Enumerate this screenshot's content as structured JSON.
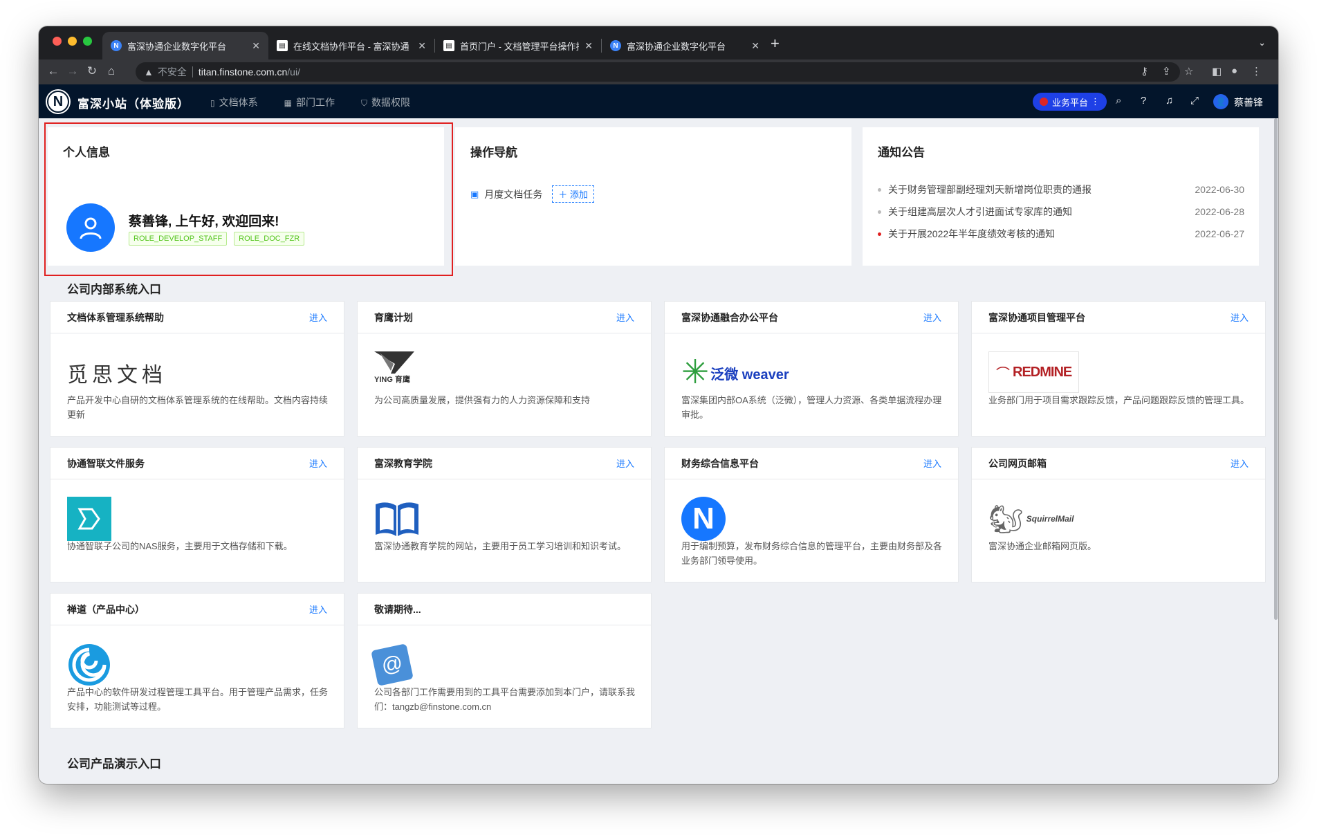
{
  "browser": {
    "tabs": [
      {
        "title": "富深协通企业数字化平台",
        "favicon": "N"
      },
      {
        "title": "在线文档协作平台 - 富深协通",
        "favicon": "doc"
      },
      {
        "title": "首页门户 - 文档管理平台操作指南",
        "favicon": "doc"
      },
      {
        "title": "富深协通企业数字化平台",
        "favicon": "N"
      }
    ],
    "security_label": "不安全",
    "url_host": "titan.finstone.com.cn",
    "url_path": "/ui/"
  },
  "header": {
    "logo": "N",
    "site_name": "富深小站（体验版）",
    "nav": [
      {
        "label": "文档体系",
        "icon": "document-icon"
      },
      {
        "label": "部门工作",
        "icon": "grid-icon"
      },
      {
        "label": "数据权限",
        "icon": "shield-icon"
      }
    ],
    "platform_button": "业务平台",
    "user_name": "蔡善锋"
  },
  "profile": {
    "title": "个人信息",
    "greeting": "蔡善锋, 上午好, 欢迎回来!",
    "roles": [
      "ROLE_DEVELOP_STAFF",
      "ROLE_DOC_FZR"
    ]
  },
  "operation_nav": {
    "title": "操作导航",
    "item": "月度文档任务",
    "add_label": "添加"
  },
  "notices": {
    "title": "通知公告",
    "items": [
      {
        "text": "关于财务管理部副经理刘天新增岗位职责的通报",
        "date": "2022-06-30",
        "highlight": false
      },
      {
        "text": "关于组建高层次人才引进面试专家库的通知",
        "date": "2022-06-28",
        "highlight": false
      },
      {
        "text": "关于开展2022年半年度绩效考核的通知",
        "date": "2022-06-27",
        "highlight": true
      }
    ]
  },
  "internal": {
    "title": "公司内部系统入口",
    "enter_label": "进入",
    "cards": [
      {
        "title": "文档体系管理系统帮助",
        "logo_text": "觅思文档",
        "desc": "产品开发中心自研的文档体系管理系统的在线帮助。文档内容持续更新",
        "has_enter": true
      },
      {
        "title": "育鹰计划",
        "logo_text": "YING 育鹰",
        "desc": "为公司高质量发展，提供强有力的人力资源保障和支持",
        "has_enter": true
      },
      {
        "title": "富深协通融合办公平台",
        "logo_text": "泛微 weaver",
        "desc": "富深集团内部OA系统（泛微），管理人力资源、各类单据流程办理审批。",
        "has_enter": true
      },
      {
        "title": "富深协通项目管理平台",
        "logo_text": "REDMINE",
        "desc": "业务部门用于项目需求跟踪反馈，产品问题跟踪反馈的管理工具。",
        "has_enter": true
      },
      {
        "title": "协通智联文件服务",
        "logo_text": "",
        "desc": "协通智联子公司的NAS服务，主要用于文档存储和下载。",
        "has_enter": true
      },
      {
        "title": "富深教育学院",
        "logo_text": "",
        "desc": "富深协通教育学院的网站，主要用于员工学习培训和知识考试。",
        "has_enter": true
      },
      {
        "title": "财务综合信息平台",
        "logo_text": "N",
        "desc": "用于编制预算，发布财务综合信息的管理平台，主要由财务部及各业务部门领导使用。",
        "has_enter": true
      },
      {
        "title": "公司网页邮箱",
        "logo_text": "SquirrelMail",
        "desc": "富深协通企业邮箱网页版。",
        "has_enter": true
      },
      {
        "title": "禅道（产品中心）",
        "logo_text": "",
        "desc": "产品中心的软件研发过程管理工具平台。用于管理产品需求，任务安排，功能测试等过程。",
        "has_enter": true
      },
      {
        "title": "敬请期待...",
        "logo_text": "@",
        "desc": "公司各部门工作需要用到的工具平台需要添加到本门户，请联系我们：tangzb@finstone.com.cn",
        "has_enter": false
      }
    ]
  },
  "demo": {
    "title": "公司产品演示入口"
  }
}
